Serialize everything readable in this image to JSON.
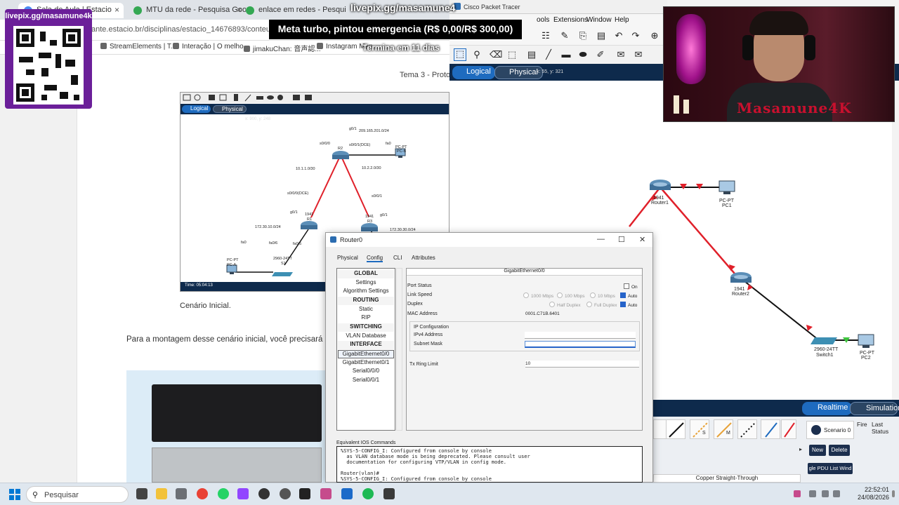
{
  "browser": {
    "tabs": [
      {
        "label": "Sala de Aula | Estacio",
        "active": true
      },
      {
        "label": "MTU da rede - Pesquisa Google",
        "active": false
      },
      {
        "label": "enlace em redes - Pesquisa Go",
        "active": false
      }
    ],
    "url": "ante.estacio.br/disciplinas/estacio_14676893/conteudos/91002",
    "bookmarks": [
      "StreamElements | T...",
      "Interação | O melho...",
      "jimakuChan: 音声認...",
      "Instagram Man"
    ]
  },
  "page": {
    "topic": "Tema 3 - Proto",
    "caption": "Cenário Inicial.",
    "paragraph": "Para a montagem desse cenário inicial, você precisará u componentes:",
    "embed": {
      "tab_logical": "Logical",
      "tab_physical": "Physical",
      "coord": "x: 900, y: 248",
      "time": "Time: 05:04:13",
      "labels": [
        {
          "text": "g0/1"
        },
        {
          "text": "209.165.201.0/24"
        },
        {
          "text": "s0/0/0"
        },
        {
          "text": "s0/0/1(DCE)"
        },
        {
          "text": "fa0"
        },
        {
          "text": "PC-PT"
        },
        {
          "text": "PC-B"
        },
        {
          "text": "R2"
        },
        {
          "text": "10.1.1.0/30"
        },
        {
          "text": "10.2.2.0/30"
        },
        {
          "text": "s0/0/0(DCE)"
        },
        {
          "text": "s0/0/1"
        },
        {
          "text": "g0/1"
        },
        {
          "text": "1941"
        },
        {
          "text": "R1"
        },
        {
          "text": "1941"
        },
        {
          "text": "R3"
        },
        {
          "text": "g0/1"
        },
        {
          "text": "172.30.10.0/24"
        },
        {
          "text": "172.30.30.0/24"
        },
        {
          "text": "fa0"
        },
        {
          "text": "fa0/6"
        },
        {
          "text": "fa0/5"
        },
        {
          "text": "PC-PT"
        },
        {
          "text": "PC-A"
        },
        {
          "text": "2960-24TT"
        },
        {
          "text": "S1"
        }
      ]
    }
  },
  "overlays": {
    "qr_title": "livepix.gg/masamune4k",
    "livepix_title": "livepix.gg/masamune4",
    "goal_text": "Meta turbo, pintou emergencia (R$ 0,00/R$ 300,00)",
    "goal_ends": "Termina em 11 dias",
    "webcam_brand": "Masamune4K"
  },
  "pt": {
    "title": "Cisco Packet Tracer",
    "menu": [
      "ools",
      "Extensions",
      "Window",
      "Help"
    ],
    "tab_logical": "Logical",
    "tab_physical": "Physical",
    "coord": "x: 55, y: 321",
    "devices": [
      {
        "model": "1941",
        "name": "Router1"
      },
      {
        "model": "PC-PT",
        "name": "PC1"
      },
      {
        "model": "1941",
        "name": "Router2"
      },
      {
        "model": "2960-24TT",
        "name": "Switch1"
      },
      {
        "model": "PC-PT",
        "name": "PC2"
      }
    ],
    "mode_realtime": "Realtime",
    "mode_simulation": "Simulation",
    "scenario": "Scenario 0",
    "fire": "Fire",
    "last_status": "Last Status",
    "btn_new": "New",
    "btn_delete": "Delete",
    "btn_pdu": "gle PDU List Wind",
    "cable_status": "Copper Straight-Through",
    "cable_labels": [
      "S",
      "M"
    ]
  },
  "dialog": {
    "title": "Router0",
    "tabs": [
      "Physical",
      "Config",
      "CLI",
      "Attributes"
    ],
    "active_tab": "Config",
    "nav": [
      {
        "label": "GLOBAL",
        "type": "header"
      },
      {
        "label": "Settings",
        "type": "item"
      },
      {
        "label": "Algorithm Settings",
        "type": "item"
      },
      {
        "label": "ROUTING",
        "type": "header"
      },
      {
        "label": "Static",
        "type": "item"
      },
      {
        "label": "RIP",
        "type": "item"
      },
      {
        "label": "SWITCHING",
        "type": "header"
      },
      {
        "label": "VLAN Database",
        "type": "item"
      },
      {
        "label": "INTERFACE",
        "type": "header"
      },
      {
        "label": "GigabitEthernet0/0",
        "type": "selected"
      },
      {
        "label": "GigabitEthernet0/1",
        "type": "item"
      },
      {
        "label": "Serial0/0/0",
        "type": "item"
      },
      {
        "label": "Serial0/0/1",
        "type": "item"
      }
    ],
    "panel_title": "GigabitEthernet0/0",
    "port_status_label": "Port Status",
    "port_status_on": "On",
    "link_speed_label": "Link Speed",
    "speed_1000": "1000 Mbps",
    "speed_100": "100 Mbps",
    "speed_10": "10 Mbps",
    "auto": "Auto",
    "duplex_label": "Duplex",
    "half_duplex": "Half Duplex",
    "full_duplex": "Full Duplex",
    "mac_label": "MAC Address",
    "mac_value": "0001.C71B.6401",
    "ip_config_label": "IP Configuration",
    "ipv4_label": "IPv4 Address",
    "ipv4_value": "",
    "subnet_label": "Subnet Mask",
    "subnet_value": "",
    "tx_ring_label": "Tx Ring Limit",
    "tx_ring_value": "10",
    "ios_label": "Equivalent IOS Commands",
    "ios_text": "%SYS-5-CONFIG_I: Configured from console by console\n  as VLAN database mode is being deprecated. Please consult user\n  documentation for configuring VTP/VLAN in config mode.\n\nRouter(vlan)#\n%SYS-5-CONFIG_I: Configured from console by console"
  },
  "taskbar": {
    "search": "Pesquisar",
    "time": "22:52:01",
    "date": "24/08/2026"
  }
}
